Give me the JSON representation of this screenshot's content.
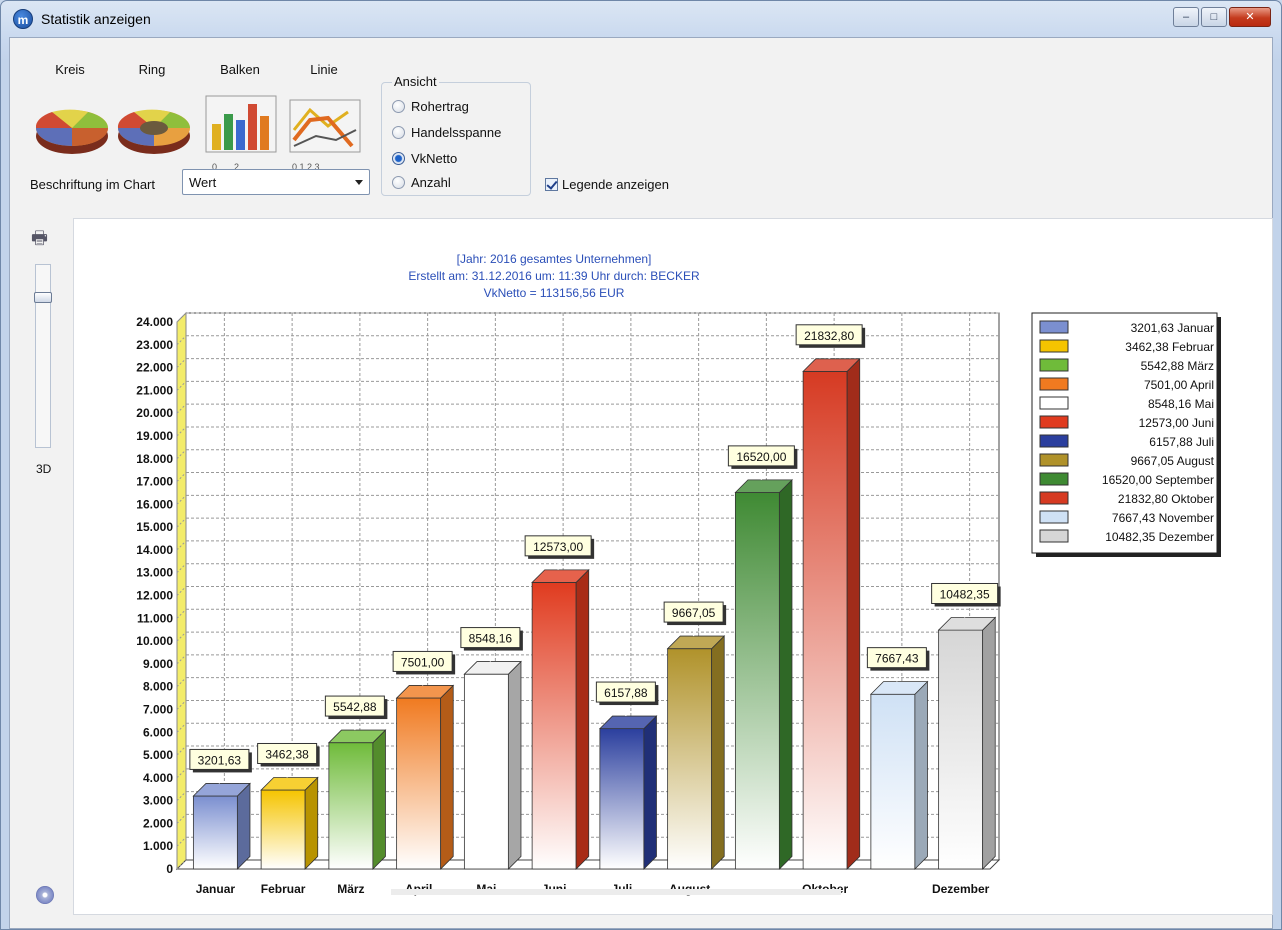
{
  "window": {
    "title": "Statistik anzeigen",
    "app_icon_letter": "m",
    "buttons": {
      "minimize": "–",
      "maximize": "□",
      "close": "✕"
    }
  },
  "chart_types": [
    {
      "label": "Kreis",
      "icon": "pie-chart-icon"
    },
    {
      "label": "Ring",
      "icon": "ring-chart-icon"
    },
    {
      "label": "Balken",
      "icon": "bar-chart-icon"
    },
    {
      "label": "Linie",
      "icon": "line-chart-icon"
    }
  ],
  "beschriftung": {
    "label": "Beschriftung im Chart",
    "value": "Wert"
  },
  "ansicht": {
    "title": "Ansicht",
    "options": [
      "Rohertrag",
      "Handelsspanne",
      "VkNetto",
      "Anzahl"
    ],
    "selected": "VkNetto"
  },
  "legende": {
    "label": "Legende anzeigen",
    "checked": true
  },
  "side": {
    "label_3d": "3D",
    "printer_icon": "printer-icon",
    "disc_icon": "disc-icon"
  },
  "chart_data": {
    "type": "bar",
    "title_lines": [
      "[Jahr: 2016  gesamtes Unternehmen]",
      "Erstellt am: 31.12.2016 um: 11:39 Uhr durch: BECKER",
      "VkNetto = 113156,56 EUR"
    ],
    "categories": [
      "Januar",
      "Februar",
      "März",
      "April",
      "Mai",
      "Juni",
      "Juli",
      "August",
      "September",
      "Oktober",
      "November",
      "Dezember"
    ],
    "x_tick_labels": [
      "Januar",
      "Februar",
      "März",
      "April",
      "Mai",
      "Juni",
      "Juli",
      "August",
      "",
      "Oktober",
      "",
      "Dezember"
    ],
    "values": [
      3201.63,
      3462.38,
      5542.88,
      7501.0,
      8548.16,
      12573.0,
      6157.88,
      9667.05,
      16520.0,
      21832.8,
      7667.43,
      10482.35
    ],
    "value_labels": [
      "3201,63",
      "3462,38",
      "5542,88",
      "7501,00",
      "8548,16",
      "12573,00",
      "6157,88",
      "9667,05",
      "16520,00",
      "21832,80",
      "7667,43",
      "10482,35"
    ],
    "legend_entries": [
      "3201,63 Januar",
      "3462,38 Februar",
      "5542,88 März",
      "7501,00 April",
      "8548,16 Mai",
      "12573,00 Juni",
      "6157,88 Juli",
      "9667,05 August",
      "16520,00 September",
      "21832,80 Oktober",
      "7667,43 November",
      "10482,35 Dezember"
    ],
    "colors": [
      "#7b8fd0",
      "#f5c400",
      "#6fbb3a",
      "#f07a20",
      "#ffffff",
      "#e03b1f",
      "#2b3f9e",
      "#b0922a",
      "#3f8a33",
      "#d63a22",
      "#cfe1f5",
      "#d6d6d6"
    ],
    "ylim": [
      0,
      24000
    ],
    "y_tick_labels": [
      "0",
      "1.000",
      "2.000",
      "3.000",
      "4.000",
      "5.000",
      "6.000",
      "7.000",
      "8.000",
      "9.000",
      "10.000",
      "11.000",
      "12.000",
      "13.000",
      "14.000",
      "15.000",
      "16.000",
      "17.000",
      "18.000",
      "19.000",
      "20.000",
      "21.000",
      "22.000",
      "23.000",
      "24.000"
    ],
    "grid": true,
    "legend_position": "right",
    "three_d": true
  }
}
